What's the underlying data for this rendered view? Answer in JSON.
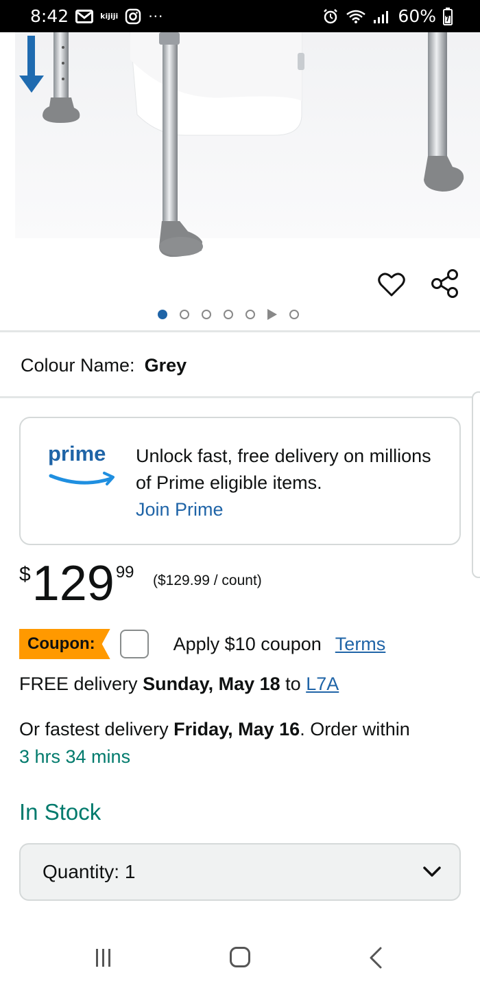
{
  "status_bar": {
    "time": "8:42",
    "app_label": "kijiji",
    "dots": "···",
    "battery": "60%"
  },
  "carousel": {
    "total_dots": 7,
    "active_index": 0
  },
  "colour": {
    "label": "Colour Name:",
    "value": "Grey"
  },
  "prime": {
    "logo_word": "prime",
    "line": "Unlock fast, free delivery on millions of Prime eligible items.",
    "link": "Join Prime",
    "brand_color": "#1f64a7"
  },
  "price": {
    "currency": "$",
    "whole": "129",
    "fraction": "99",
    "unit": "($129.99 / count)"
  },
  "coupon": {
    "badge": "Coupon:",
    "text": "Apply $10 coupon",
    "terms": "Terms",
    "badge_color": "#ff9900"
  },
  "delivery": {
    "free_prefix": "FREE delivery",
    "free_date": "Sunday, May 18",
    "to": "to",
    "postal": "L7A",
    "fast_prefix": "Or fastest delivery",
    "fast_date": "Friday, May 16",
    "order_within": ". Order within",
    "countdown": "3 hrs 34 mins"
  },
  "stock": {
    "status": "In Stock",
    "color": "#007a6c"
  },
  "quantity": {
    "label": "Quantity:",
    "value": "1"
  },
  "icons": {
    "heart": "heart-icon",
    "share": "share-icon",
    "mail": "mail-icon",
    "instagram": "instagram-icon",
    "alarm": "alarm-icon",
    "wifi": "wifi-icon",
    "signal": "signal-icon",
    "battery": "battery-icon"
  }
}
